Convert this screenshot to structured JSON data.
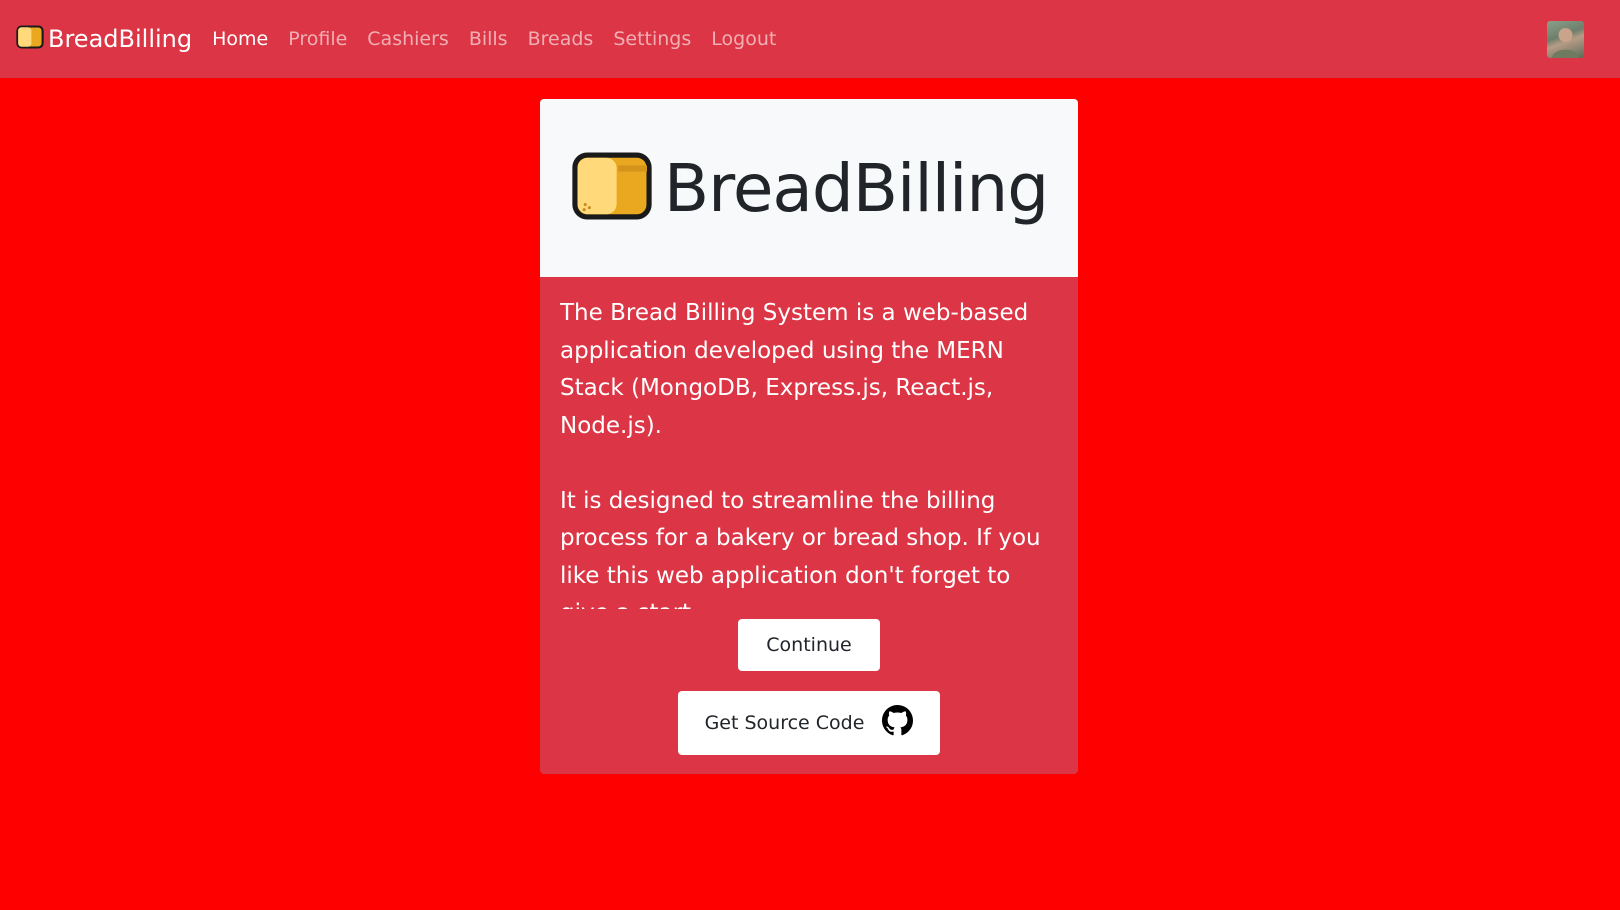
{
  "navbar": {
    "brand": "BreadBilling",
    "links": [
      {
        "label": "Home",
        "active": true
      },
      {
        "label": "Profile",
        "active": false
      },
      {
        "label": "Cashiers",
        "active": false
      },
      {
        "label": "Bills",
        "active": false
      },
      {
        "label": "Breads",
        "active": false
      },
      {
        "label": "Settings",
        "active": false
      },
      {
        "label": "Logout",
        "active": false
      }
    ],
    "avatar_icon": "user-avatar"
  },
  "card": {
    "title": "BreadBilling",
    "logo_icon": "bread-icon",
    "description": "The Bread Billing System is a web-based application developed using the MERN Stack (MongoDB, Express.js, React.js, Node.js).\n\nIt is designed to streamline the billing process for a bakery or bread shop. If you like this web application don't forget to give a start.",
    "continue_label": "Continue",
    "source_label": "Get Source Code",
    "source_icon": "github-icon"
  },
  "colors": {
    "background": "#ff0000",
    "primary": "#dc3545",
    "header_bg": "#f8f9fa",
    "bread": "#e9a81f",
    "bread_light": "#ffd97a"
  }
}
